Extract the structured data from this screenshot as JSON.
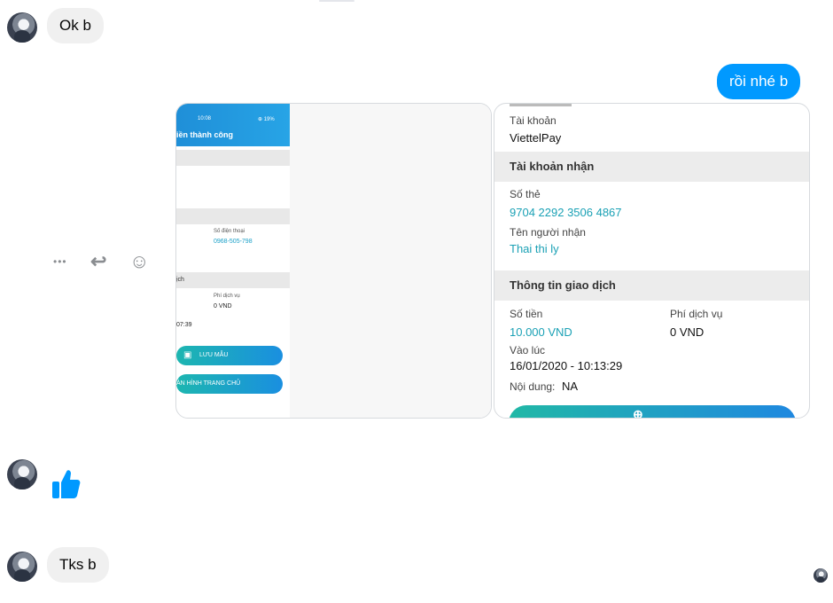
{
  "messages": {
    "msg1": "Ok b",
    "msg2": "rồi nhé b",
    "msg3": "Tks b"
  },
  "actions": {
    "more": "•••",
    "reply": "↩",
    "react": "☺"
  },
  "image_left": {
    "time": "10:08",
    "battery": "⊕ 19%",
    "title": "iền thành công",
    "phone_label": "Số điện thoại",
    "phone_value": "0968-505-798",
    "section": "ịch",
    "fee_label": "Phí dịch vụ",
    "fee_value": "0 VND",
    "time_value": "07:39",
    "save_button": "LƯU MẪU",
    "home_button": "ÀN HÌNH TRANG CHỦ"
  },
  "image_right": {
    "account_label": "Tài khoản",
    "account_value": "ViettelPay",
    "receiver_section": "Tài khoản nhận",
    "card_label": "Số thẻ",
    "card_value": "9704 2292 3506 4867",
    "recipient_label": "Tên người nhận",
    "recipient_value": "Thai thi ly",
    "txn_section": "Thông tin giao dịch",
    "amount_label": "Số tiền",
    "amount_value": "10.000 VND",
    "fee_label": "Phí dịch vụ",
    "fee_value": "0 VND",
    "at_label": "Vào lúc",
    "at_value": "16/01/2020 - 10:13:29",
    "content_label": "Nội dung:",
    "content_value": "NA"
  },
  "colors": {
    "outgoing_bubble": "#0099ff",
    "incoming_bubble": "#f0f0f0",
    "like_icon": "#0099ff",
    "teal_text": "#1ba1b5"
  }
}
